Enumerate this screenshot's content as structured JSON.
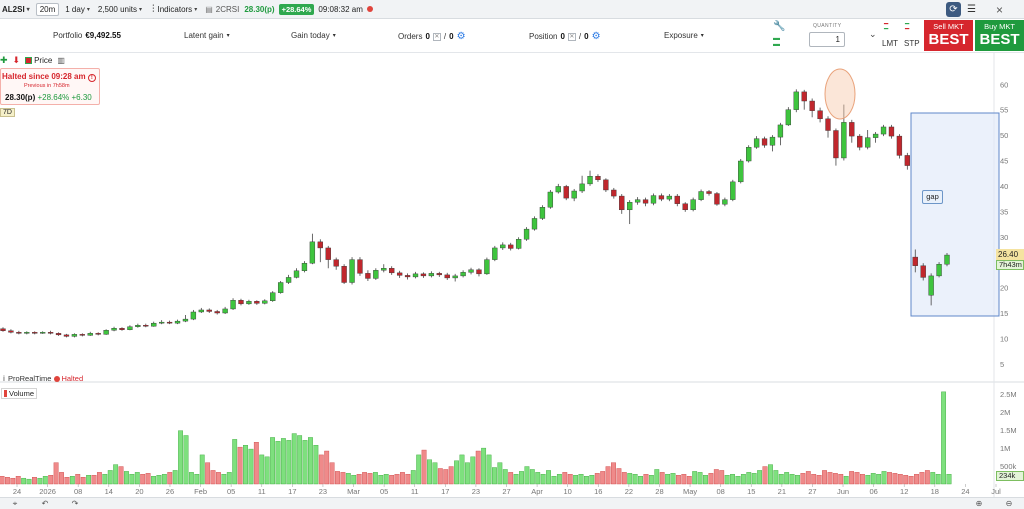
{
  "topbar": {
    "symbol": "AL2SI",
    "interval": "20m",
    "period": "1 day",
    "units": "2,500 units",
    "indicators": "Indicators",
    "symbol2": "2CRSI",
    "last_price": "28.30(p)",
    "change_pct": "+28.64%",
    "time": "09:08:32 am"
  },
  "info": {
    "portfolio_label": "Portfolio",
    "portfolio_value": "€9,492.55",
    "latent_gain": "Latent gain",
    "gain_today": "Gain today",
    "orders_label": "Orders",
    "orders_a": "0",
    "orders_b": "0",
    "position_label": "Position",
    "position_a": "0",
    "position_b": "0",
    "exposure": "Exposure",
    "quantity_label": "QUANTITY",
    "quantity_value": "1",
    "lmt": "LMT",
    "stp": "STP",
    "sell_label": "Sell MKT",
    "sell_big": "BEST",
    "buy_label": "Buy MKT",
    "buy_big": "BEST"
  },
  "chart_tools": {
    "price_label": "Price"
  },
  "halted": {
    "title": "Halted since 09:28 am",
    "sub": "Previous in 7h58m",
    "price": "28.30(p)",
    "change": "+28.64% +6.30",
    "range_badge": "7D"
  },
  "source": {
    "name": "ProRealTime",
    "status": "Halted"
  },
  "volume_label": "Volume",
  "annotation_gap": "gap",
  "price_tag": "26.40",
  "time_tag": "7h43m",
  "vol_tag": "234k",
  "colors": {
    "up": "#3ec43e",
    "down": "#c0272d",
    "vol_up": "#7ee07e",
    "vol_down": "#ef8a8a",
    "gap_fill": "#dde7f8",
    "gap_stroke": "#5f87c9"
  },
  "chart_data": {
    "type": "candlestick",
    "y_ticks": [
      60,
      55,
      50,
      45,
      40,
      35,
      30,
      25,
      20,
      15,
      10,
      5
    ],
    "ylim": [
      3,
      63
    ],
    "vol_ticks": [
      "2.5M",
      "2M",
      "1.5M",
      "1M",
      "500k"
    ],
    "vol_max": 2700000,
    "x_ticks": [
      "24",
      "2026",
      "08",
      "14",
      "20",
      "26",
      "Feb",
      "05",
      "11",
      "17",
      "23",
      "Mar",
      "05",
      "11",
      "17",
      "23",
      "27",
      "Apr",
      "10",
      "16",
      "22",
      "28",
      "May",
      "08",
      "15",
      "21",
      "27",
      "Jun",
      "06",
      "12",
      "18",
      "24",
      "Jul"
    ],
    "candles": [
      [
        11.9,
        11.5,
        12.2,
        11.3
      ],
      [
        11.5,
        11.2,
        11.8,
        11.0
      ],
      [
        11.2,
        11.0,
        11.5,
        10.8
      ],
      [
        11.0,
        11.2,
        11.4,
        10.8
      ],
      [
        11.2,
        11.0,
        11.4,
        10.8
      ],
      [
        11.0,
        11.2,
        11.4,
        10.9
      ],
      [
        11.2,
        11.0,
        11.5,
        10.8
      ],
      [
        11.0,
        10.7,
        11.2,
        10.5
      ],
      [
        10.7,
        10.4,
        10.9,
        10.2
      ],
      [
        10.4,
        10.8,
        11.0,
        10.2
      ],
      [
        10.8,
        10.6,
        11.0,
        10.4
      ],
      [
        10.6,
        11.0,
        11.3,
        10.5
      ],
      [
        11.0,
        10.8,
        11.2,
        10.6
      ],
      [
        10.8,
        11.6,
        11.8,
        10.7
      ],
      [
        11.6,
        12.0,
        12.3,
        11.4
      ],
      [
        12.0,
        11.7,
        12.2,
        11.5
      ],
      [
        11.7,
        12.3,
        12.6,
        11.6
      ],
      [
        12.3,
        12.6,
        12.9,
        12.1
      ],
      [
        12.6,
        12.4,
        12.9,
        12.2
      ],
      [
        12.4,
        13.0,
        13.3,
        12.3
      ],
      [
        13.0,
        13.2,
        13.6,
        12.8
      ],
      [
        13.2,
        13.0,
        13.5,
        12.8
      ],
      [
        13.0,
        13.4,
        13.7,
        12.8
      ],
      [
        13.4,
        13.8,
        14.6,
        13.2
      ],
      [
        13.8,
        15.2,
        15.6,
        13.6
      ],
      [
        15.2,
        15.6,
        16.0,
        15.0
      ],
      [
        15.6,
        15.3,
        15.9,
        15.0
      ],
      [
        15.3,
        15.0,
        15.6,
        14.7
      ],
      [
        15.0,
        15.8,
        16.2,
        14.8
      ],
      [
        15.8,
        17.5,
        17.9,
        15.6
      ],
      [
        17.5,
        16.8,
        17.8,
        16.5
      ],
      [
        16.8,
        17.3,
        17.6,
        16.6
      ],
      [
        17.3,
        16.9,
        17.5,
        16.6
      ],
      [
        16.9,
        17.4,
        17.7,
        16.7
      ],
      [
        17.4,
        19.0,
        19.3,
        17.2
      ],
      [
        19.0,
        21.0,
        21.3,
        18.8
      ],
      [
        21.0,
        22.0,
        22.5,
        20.7
      ],
      [
        22.0,
        23.3,
        23.8,
        21.8
      ],
      [
        23.3,
        24.8,
        25.2,
        23.0
      ],
      [
        24.8,
        29.0,
        30.6,
        24.6
      ],
      [
        29.0,
        27.8,
        29.5,
        25.0
      ],
      [
        27.8,
        25.5,
        28.2,
        23.8
      ],
      [
        25.5,
        24.2,
        25.9,
        23.5
      ],
      [
        24.2,
        21.0,
        24.6,
        20.7
      ],
      [
        21.0,
        25.5,
        26.0,
        20.6
      ],
      [
        25.5,
        22.8,
        26.0,
        22.3
      ],
      [
        22.8,
        21.8,
        23.4,
        21.3
      ],
      [
        21.8,
        23.4,
        23.8,
        21.5
      ],
      [
        23.4,
        23.8,
        24.6,
        23.0
      ],
      [
        23.8,
        22.9,
        24.2,
        22.5
      ],
      [
        22.9,
        22.4,
        23.3,
        21.9
      ],
      [
        22.4,
        22.1,
        22.8,
        21.6
      ],
      [
        22.1,
        22.7,
        23.1,
        21.8
      ],
      [
        22.7,
        22.3,
        23.0,
        21.9
      ],
      [
        22.3,
        22.8,
        23.2,
        22.0
      ],
      [
        22.8,
        22.5,
        23.1,
        22.1
      ],
      [
        22.5,
        21.9,
        22.9,
        21.5
      ],
      [
        21.9,
        22.3,
        22.7,
        21.2
      ],
      [
        22.3,
        23.0,
        23.4,
        22.0
      ],
      [
        23.0,
        23.5,
        23.9,
        22.6
      ],
      [
        23.5,
        22.7,
        23.8,
        22.2
      ],
      [
        22.7,
        25.5,
        25.9,
        22.5
      ],
      [
        25.5,
        27.8,
        28.2,
        25.2
      ],
      [
        27.8,
        28.4,
        28.9,
        27.4
      ],
      [
        28.4,
        27.7,
        28.8,
        27.3
      ],
      [
        27.7,
        29.5,
        29.9,
        27.5
      ],
      [
        29.5,
        31.5,
        31.9,
        29.2
      ],
      [
        31.5,
        33.6,
        34.0,
        31.2
      ],
      [
        33.6,
        35.8,
        36.2,
        33.3
      ],
      [
        35.8,
        38.8,
        39.2,
        35.5
      ],
      [
        38.8,
        39.9,
        40.4,
        38.5
      ],
      [
        39.9,
        37.6,
        40.2,
        37.2
      ],
      [
        37.6,
        39.0,
        39.4,
        37.0
      ],
      [
        39.0,
        40.4,
        42.0,
        38.6
      ],
      [
        40.4,
        41.9,
        43.0,
        40.0
      ],
      [
        41.9,
        41.2,
        42.3,
        40.8
      ],
      [
        41.2,
        39.2,
        41.5,
        38.8
      ],
      [
        39.2,
        38.0,
        39.6,
        37.5
      ],
      [
        38.0,
        35.3,
        38.4,
        34.5
      ],
      [
        35.3,
        36.8,
        37.2,
        32.5
      ],
      [
        36.8,
        37.3,
        37.8,
        36.3
      ],
      [
        37.3,
        36.6,
        37.7,
        36.0
      ],
      [
        36.6,
        38.1,
        38.5,
        36.2
      ],
      [
        38.1,
        37.4,
        38.5,
        37.0
      ],
      [
        37.4,
        38.0,
        38.4,
        37.0
      ],
      [
        38.0,
        36.5,
        38.4,
        36.0
      ],
      [
        36.5,
        35.3,
        36.8,
        34.9
      ],
      [
        35.3,
        37.3,
        37.7,
        35.0
      ],
      [
        37.3,
        38.9,
        39.3,
        37.0
      ],
      [
        38.9,
        38.5,
        39.2,
        38.1
      ],
      [
        38.5,
        36.4,
        38.8,
        36.1
      ],
      [
        36.4,
        37.3,
        37.7,
        36.0
      ],
      [
        37.3,
        40.8,
        41.2,
        37.0
      ],
      [
        40.8,
        44.9,
        45.3,
        40.5
      ],
      [
        44.9,
        47.6,
        48.0,
        44.6
      ],
      [
        47.6,
        49.3,
        49.8,
        47.3
      ],
      [
        49.3,
        48.0,
        49.7,
        47.5
      ],
      [
        48.0,
        49.6,
        50.0,
        46.8
      ],
      [
        49.6,
        52.0,
        52.4,
        48.0
      ],
      [
        52.0,
        55.0,
        55.5,
        51.8
      ],
      [
        55.0,
        58.5,
        59.0,
        54.5
      ],
      [
        58.5,
        56.7,
        58.9,
        55.0
      ],
      [
        56.7,
        54.8,
        57.2,
        53.5
      ],
      [
        54.8,
        53.2,
        55.4,
        52.5
      ],
      [
        53.2,
        50.9,
        53.7,
        49.5
      ],
      [
        50.9,
        45.5,
        51.3,
        44.0
      ],
      [
        45.5,
        52.5,
        56.0,
        45.0
      ],
      [
        52.5,
        49.8,
        53.0,
        48.5
      ],
      [
        49.8,
        47.6,
        50.2,
        47.0
      ],
      [
        47.6,
        49.5,
        51.0,
        47.2
      ],
      [
        49.5,
        50.2,
        50.6,
        48.5
      ],
      [
        50.2,
        51.6,
        52.0,
        49.8
      ],
      [
        51.6,
        49.8,
        52.0,
        49.3
      ],
      [
        49.8,
        46.0,
        50.2,
        45.4
      ],
      [
        46.0,
        44.0,
        46.5,
        43.2
      ],
      [
        26.0,
        24.3,
        27.5,
        23.0
      ],
      [
        24.3,
        22.0,
        24.8,
        21.4
      ],
      [
        18.5,
        22.3,
        22.8,
        16.5
      ],
      [
        22.3,
        24.6,
        25.0,
        22.0
      ],
      [
        24.6,
        26.4,
        26.8,
        24.2
      ]
    ],
    "volumes": [
      0.08,
      0.07,
      0.06,
      0.08,
      0.06,
      0.05,
      0.07,
      0.06,
      0.08,
      0.09,
      0.22,
      0.12,
      0.07,
      0.08,
      0.1,
      0.07,
      0.09,
      0.09,
      0.12,
      0.1,
      0.14,
      0.2,
      0.18,
      0.13,
      0.1,
      0.12,
      0.1,
      0.11,
      0.08,
      0.09,
      0.1,
      0.12,
      0.14,
      0.55,
      0.5,
      0.12,
      0.1,
      0.3,
      0.22,
      0.14,
      0.12,
      0.1,
      0.12,
      0.46,
      0.38,
      0.4,
      0.36,
      0.43,
      0.3,
      0.28,
      0.48,
      0.44,
      0.47,
      0.45,
      0.52,
      0.5,
      0.45,
      0.48,
      0.4,
      0.3,
      0.34,
      0.22,
      0.13,
      0.12,
      0.11,
      0.09,
      0.1,
      0.12,
      0.11,
      0.12,
      0.09,
      0.1,
      0.09,
      0.1,
      0.12,
      0.1,
      0.14,
      0.3,
      0.35,
      0.25,
      0.22,
      0.16,
      0.15,
      0.18,
      0.24,
      0.3,
      0.22,
      0.28,
      0.34,
      0.37,
      0.3,
      0.17,
      0.22,
      0.15,
      0.12,
      0.1,
      0.13,
      0.18,
      0.15,
      0.12,
      0.1,
      0.14,
      0.08,
      0.1,
      0.12,
      0.1,
      0.09,
      0.1,
      0.08,
      0.09,
      0.11,
      0.13,
      0.18,
      0.22,
      0.16,
      0.12,
      0.11,
      0.1,
      0.08,
      0.1,
      0.09,
      0.15,
      0.12,
      0.1,
      0.11,
      0.09,
      0.1,
      0.08,
      0.13,
      0.12,
      0.09,
      0.11,
      0.15,
      0.14,
      0.09,
      0.1,
      0.08,
      0.1,
      0.12,
      0.11,
      0.14,
      0.18,
      0.2,
      0.14,
      0.1,
      0.12,
      0.1,
      0.09,
      0.11,
      0.13,
      0.1,
      0.09,
      0.14,
      0.12,
      0.11,
      0.1,
      0.08,
      0.13,
      0.12,
      0.1,
      0.09,
      0.11,
      0.1,
      0.13,
      0.12,
      0.11,
      0.1,
      0.09,
      0.08,
      0.1,
      0.12,
      0.14,
      0.12,
      0.1,
      0.95,
      0.1
    ]
  }
}
